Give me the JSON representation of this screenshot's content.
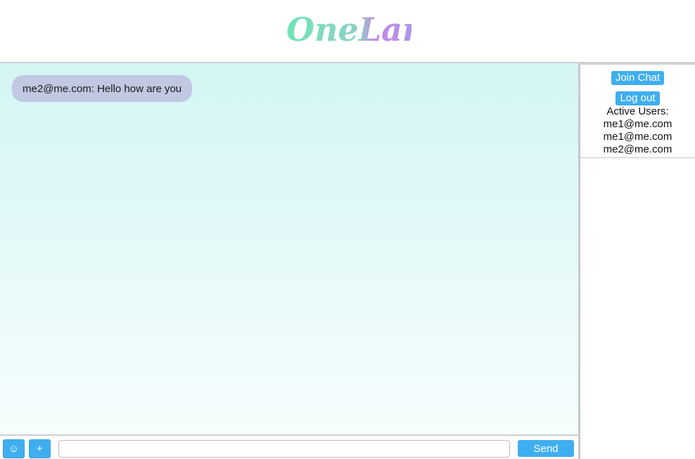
{
  "header": {
    "logo_text": "OneLang"
  },
  "chat": {
    "messages": [
      {
        "text": "me2@me.com: Hello how are you"
      }
    ]
  },
  "composer": {
    "emoji_label": "☺",
    "plus_label": "+",
    "input_value": "",
    "input_placeholder": "",
    "send_label": "Send"
  },
  "sidebar": {
    "join_label": "Join Chat",
    "logout_label": "Log out",
    "active_users_label": "Active Users:",
    "active_users": [
      "me1@me.com",
      "me1@me.com",
      "me2@me.com"
    ]
  },
  "colors": {
    "accent": "#3faef0",
    "bubble": "#c0c8e2",
    "logo_green": "#6ee0b0",
    "logo_purple": "#a98be8"
  }
}
